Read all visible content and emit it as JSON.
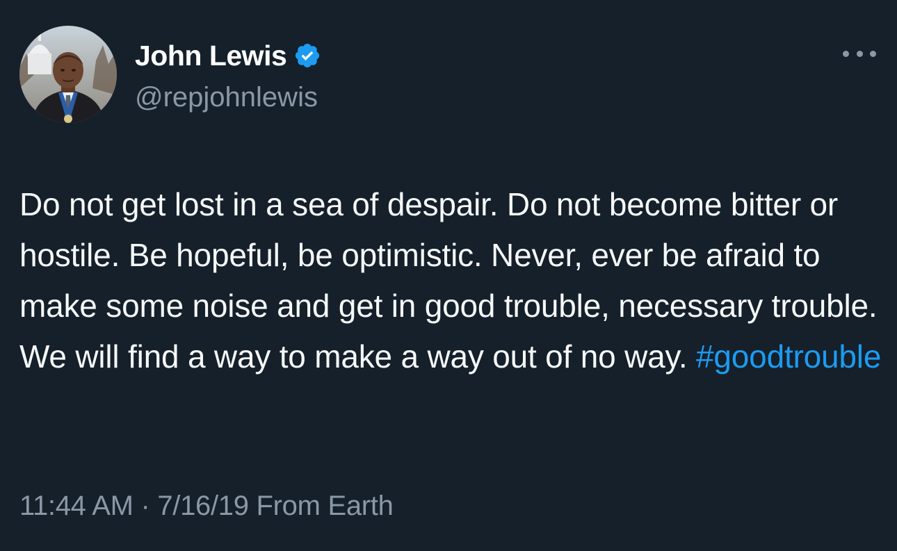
{
  "tweet": {
    "author": {
      "display_name": "John Lewis",
      "handle": "@repjohnlewis",
      "verified": true,
      "verified_color": "#1d9bf0"
    },
    "more_icon": "more-horizontal-icon",
    "text": "Do not get lost in a sea of despair. Do not become bitter or hostile. Be hopeful, be optimistic. Never, ever be afraid to make some noise and get in good trouble, necessary trouble. We will find a way to make a way out of no way. ",
    "hashtag": "#goodtrouble",
    "time": "11:44 AM",
    "separator": "·",
    "date": "7/16/19",
    "source": "From Earth"
  },
  "colors": {
    "background": "#15202b",
    "text_primary": "#f7f9f9",
    "text_secondary": "#8b98a5",
    "accent": "#1d9bf0"
  }
}
